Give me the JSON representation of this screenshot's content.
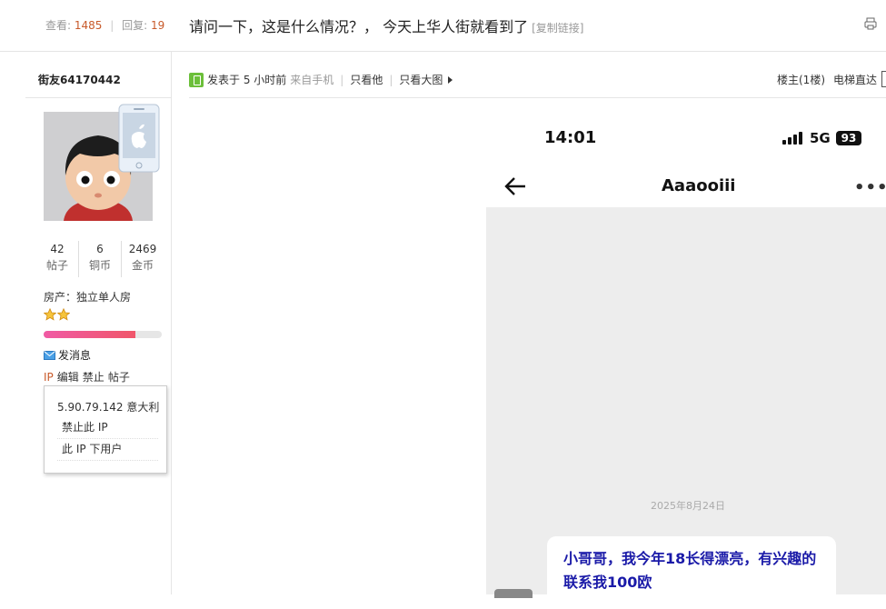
{
  "thread": {
    "views_label": "查看:",
    "views": "1485",
    "replies_label": "回复:",
    "replies": "19",
    "title": "请问一下，这是什么情况？， 今天上华人街就看到了",
    "copy_link": "[复制链接]"
  },
  "author": {
    "username": "街友64170442",
    "stats": [
      {
        "value": "42",
        "label": "帖子"
      },
      {
        "value": "6",
        "label": "铜币"
      },
      {
        "value": "2469",
        "label": "金币"
      }
    ],
    "house": "房产：独立单人房",
    "star_count": 2,
    "level_progress": 0.78,
    "send_message": "发消息",
    "actions": {
      "ip": "IP",
      "edit": "编辑",
      "ban": "禁止",
      "posts": "帖子"
    },
    "ip_popup": {
      "address": "5.90.79.142 意大利",
      "ban_ip": "禁止此 IP",
      "ip_users": "此 IP 下用户"
    }
  },
  "post": {
    "posted": "发表于 5 小时前",
    "from_mobile": "来自手机",
    "only_author": "只看他",
    "only_big_images": "只看大图",
    "floor_label": "楼主(1楼)",
    "elevator": "电梯直达"
  },
  "embedded_screenshot": {
    "time": "14:01",
    "network": "5G",
    "battery": "93",
    "chat_name": "Aaaooiii",
    "more": "•••",
    "date": "2025年8月24日",
    "message": "小哥哥，我今年18长得漂亮，有兴趣的联系我100欧"
  },
  "colors": {
    "accent": "#c85a2a",
    "message_text": "#1a1aa8",
    "progress_start": "#f05aa4",
    "progress_end": "#f0566a"
  }
}
